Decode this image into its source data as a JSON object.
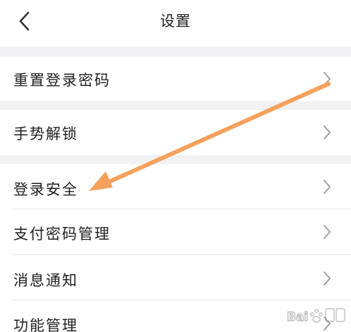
{
  "header": {
    "title": "设置",
    "back_icon": "chevron-left-icon"
  },
  "settings_items": [
    {
      "label": "重置登录密码",
      "icon": "chevron-right-icon"
    },
    {
      "label": "手势解锁",
      "icon": "chevron-right-icon"
    },
    {
      "label": "登录安全",
      "icon": "chevron-right-icon"
    },
    {
      "label": "支付密码管理",
      "icon": "chevron-right-icon"
    },
    {
      "label": "消息通知",
      "icon": "chevron-right-icon"
    },
    {
      "label": "功能管理",
      "icon": "chevron-right-icon"
    }
  ],
  "annotation": {
    "type": "arrow",
    "points_to": "登录安全",
    "color": "#f5a15c"
  },
  "watermark": {
    "text": "Bai百度经验",
    "icon": "baidu-paw-icon"
  },
  "colors": {
    "background": "#ffffff",
    "section_gap": "#f2f2f4",
    "text": "#1e1e1e",
    "chevron": "#9a9a9a",
    "divider": "#e6e6e6"
  }
}
